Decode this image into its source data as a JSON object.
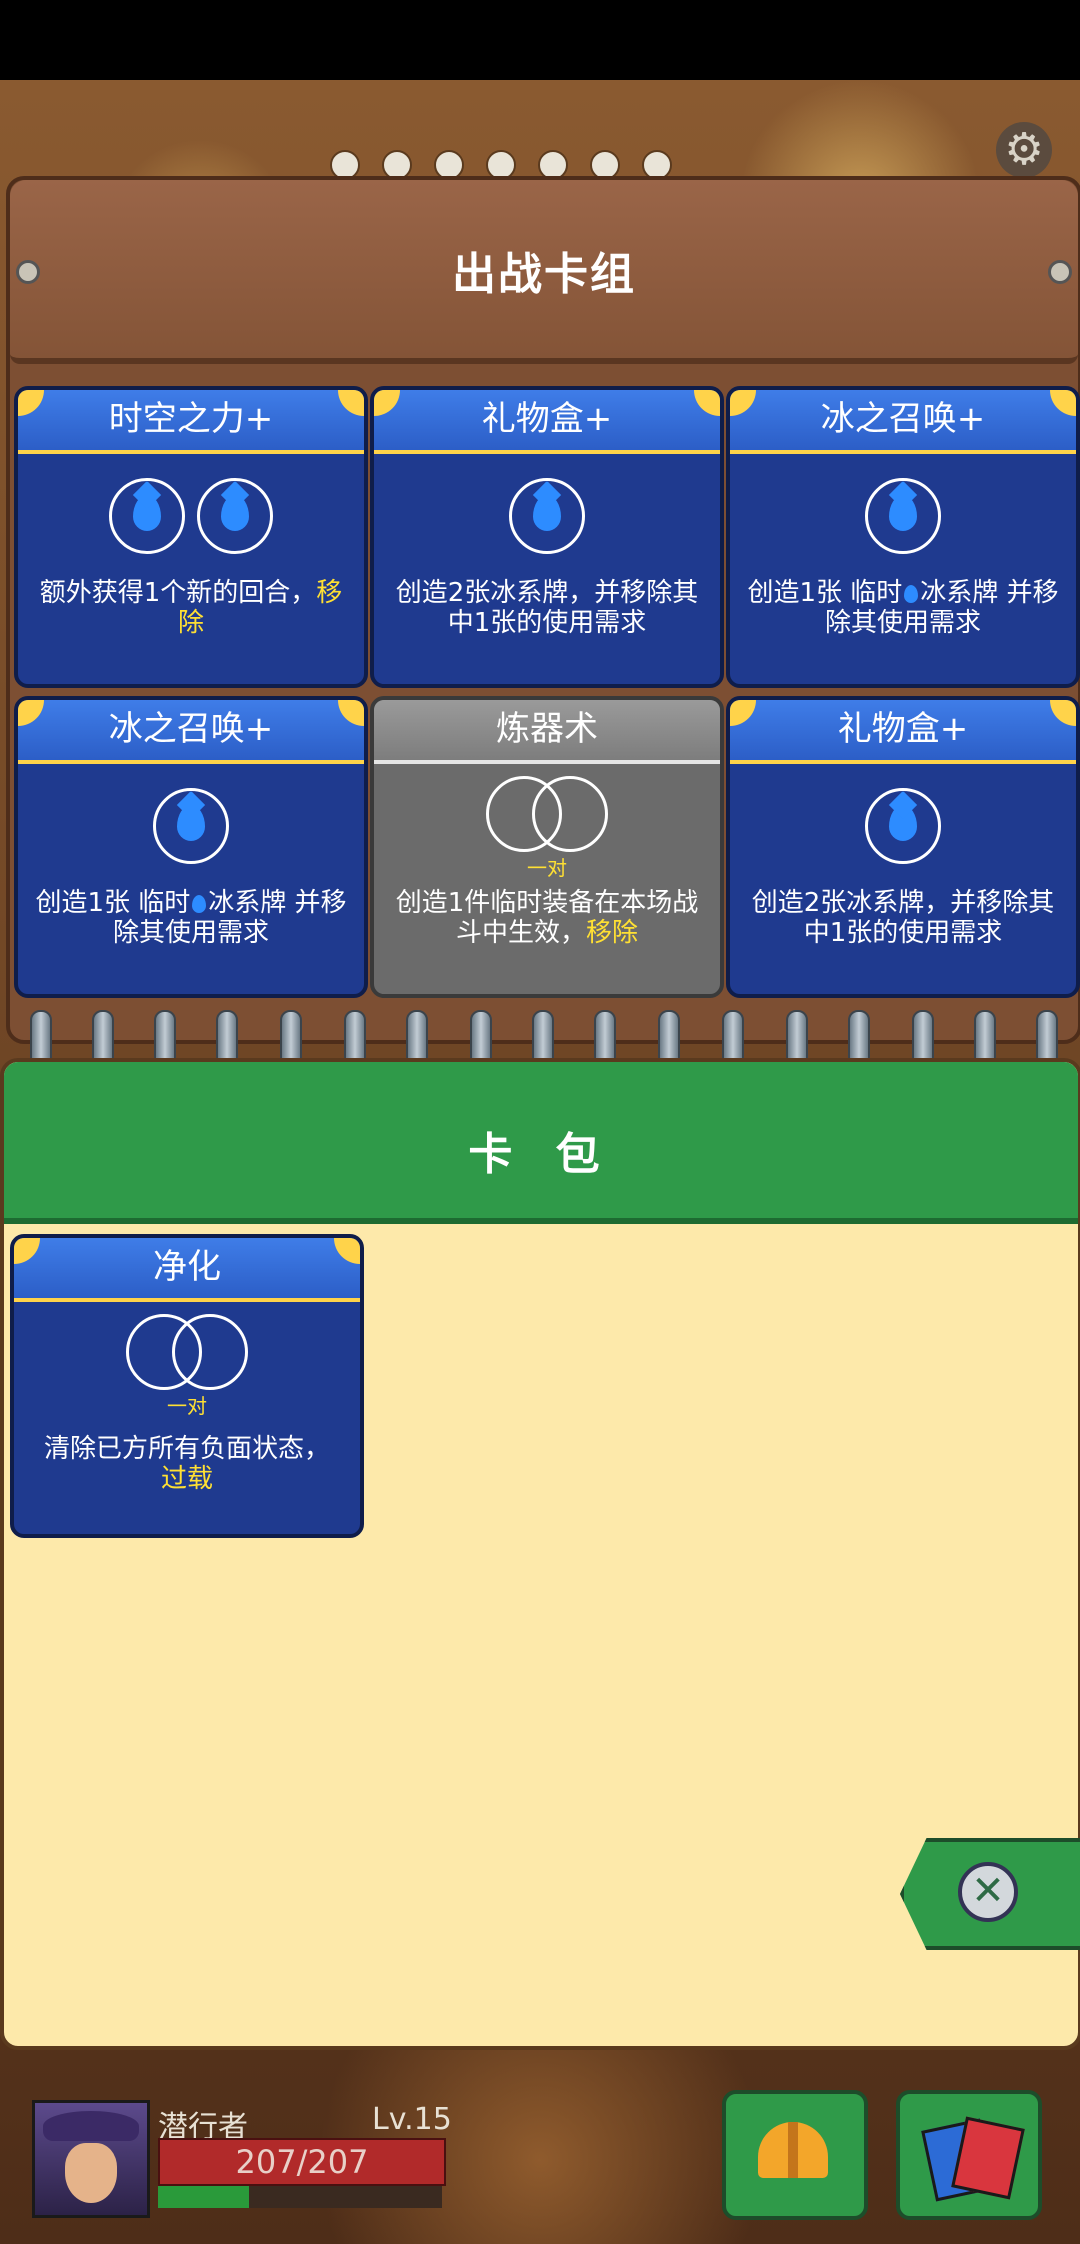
{
  "deck": {
    "title": "出战卡组",
    "cards": [
      {
        "name": "时空之力+",
        "style": "blue",
        "cost_type": "drops",
        "cost_count": 2,
        "desc": "额外获得1个新的回合，",
        "keyword": "移除"
      },
      {
        "name": "礼物盒+",
        "style": "blue",
        "cost_type": "drops",
        "cost_count": 1,
        "desc": "创造2张冰系牌，并移除其中1张的使用需求",
        "keyword": ""
      },
      {
        "name": "冰之召唤+",
        "style": "blue",
        "cost_type": "drops",
        "cost_count": 1,
        "desc_a": "创造1张 临时",
        "desc_b": "冰系牌 并移除其使用需求"
      },
      {
        "name": "冰之召唤+",
        "style": "blue",
        "cost_type": "drops",
        "cost_count": 1,
        "desc_a": "创造1张 临时",
        "desc_b": "冰系牌 并移除其使用需求"
      },
      {
        "name": "炼器术",
        "style": "gray",
        "cost_type": "pair",
        "pair_label": "一对",
        "desc": "创造1件临时装备在本场战斗中生效，",
        "keyword": "移除"
      },
      {
        "name": "礼物盒+",
        "style": "blue",
        "cost_type": "drops",
        "cost_count": 1,
        "desc": "创造2张冰系牌，并移除其中1张的使用需求",
        "keyword": ""
      }
    ]
  },
  "pack": {
    "title": "卡 包",
    "cards": [
      {
        "name": "净化",
        "style": "blue",
        "cost_type": "pair",
        "pair_label": "一对",
        "desc": "清除已方所有负面状态，",
        "keyword": "过载"
      }
    ]
  },
  "player": {
    "name": "潜行者",
    "level": "Lv.15",
    "hp": "207/207",
    "xp_fraction": 0.32
  },
  "icons": {
    "settings": "gear-icon",
    "close": "close-icon",
    "equipment": "helmet-icon",
    "cards": "cards-icon"
  },
  "colors": {
    "card_blue": "#1f3a8f",
    "card_gray": "#6b6b6b",
    "keyword_yellow": "#ffe033",
    "pack_green": "#2f9a49",
    "pack_bg": "#fde9aa"
  }
}
